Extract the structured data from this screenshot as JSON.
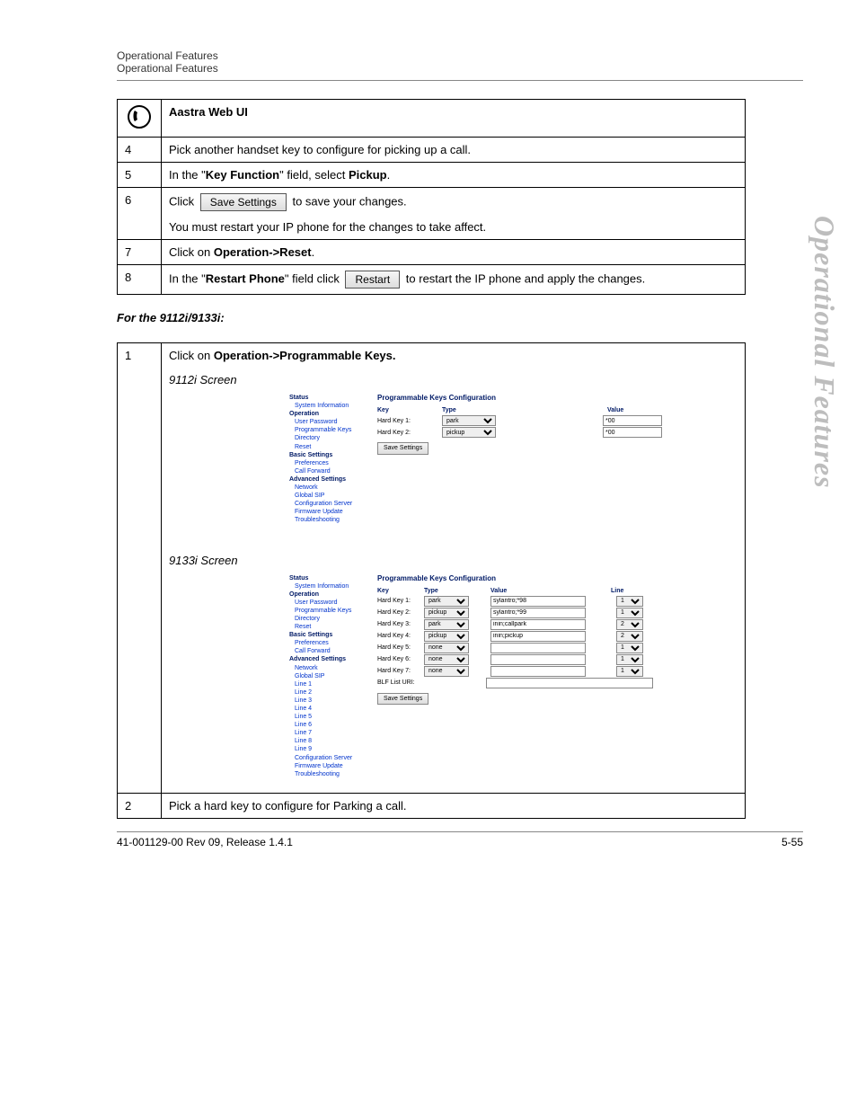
{
  "header": {
    "line1": "Operational Features",
    "line2": "Operational Features"
  },
  "side_title": "Operational Features",
  "webui": {
    "title": "Aastra Web UI",
    "steps": {
      "s4": {
        "num": "4",
        "text": "Pick another handset key to configure for picking up a call."
      },
      "s5": {
        "num": "5",
        "pre": "In the \"",
        "bold": "Key Function",
        "post": "\" field, select ",
        "bold2": "Pickup",
        "tail": "."
      },
      "s6": {
        "num": "6",
        "pre": "Click ",
        "btn": "Save Settings",
        "post": " to save your changes.",
        "note": "You must restart your IP phone for the changes to take affect."
      },
      "s7": {
        "num": "7",
        "pre": "Click on ",
        "bold": "Operation->Reset",
        "tail": "."
      },
      "s8": {
        "num": "8",
        "pre": "In the \"",
        "bold": "Restart Phone",
        "mid": "\" field click ",
        "btn": "Restart",
        "post": " to restart the IP phone and apply the changes."
      }
    },
    "subhead": "For the 9112i/9133i:",
    "step1": {
      "num": "1",
      "pre": "Click on ",
      "bold": "Operation->Programmable Keys."
    },
    "screen1_label": "9112i Screen",
    "screen2_label": "9133i Screen",
    "step2": {
      "num": "2",
      "text": "Pick a hard key to configure for Parking a call."
    }
  },
  "nav": {
    "status": "Status",
    "sysinfo": "System Information",
    "operation": "Operation",
    "userpw": "User Password",
    "progkeys": "Programmable Keys",
    "directory": "Directory",
    "reset": "Reset",
    "basic": "Basic Settings",
    "prefs": "Preferences",
    "callfwd": "Call Forward",
    "advanced": "Advanced Settings",
    "network": "Network",
    "globalsip": "Global SIP",
    "cfgsrv": "Configuration Server",
    "fwupd": "Firmware Update",
    "tshoot": "Troubleshooting",
    "lines": [
      "Line 1",
      "Line 2",
      "Line 3",
      "Line 4",
      "Line 5",
      "Line 6",
      "Line 7",
      "Line 8",
      "Line 9"
    ]
  },
  "ui9112": {
    "title": "Programmable Keys Configuration",
    "cols": {
      "key": "Key",
      "type": "Type",
      "value": "Value"
    },
    "rows": [
      {
        "key": "Hard Key 1:",
        "type": "park",
        "value": "*00"
      },
      {
        "key": "Hard Key 2:",
        "type": "pickup",
        "value": "*00"
      }
    ],
    "save": "Save Settings"
  },
  "ui9133": {
    "title": "Programmable Keys Configuration",
    "cols": {
      "key": "Key",
      "type": "Type",
      "value": "Value",
      "line": "Line"
    },
    "rows": [
      {
        "key": "Hard Key 1:",
        "type": "park",
        "value": "sylantro;*98",
        "line": "1"
      },
      {
        "key": "Hard Key 2:",
        "type": "pickup",
        "value": "sylantro;*99",
        "line": "1"
      },
      {
        "key": "Hard Key 3:",
        "type": "park",
        "value": "inin;callpark",
        "line": "2"
      },
      {
        "key": "Hard Key 4:",
        "type": "pickup",
        "value": "inin;pickup",
        "line": "2"
      },
      {
        "key": "Hard Key 5:",
        "type": "none",
        "value": "",
        "line": "1"
      },
      {
        "key": "Hard Key 6:",
        "type": "none",
        "value": "",
        "line": "1"
      },
      {
        "key": "Hard Key 7:",
        "type": "none",
        "value": "",
        "line": "1"
      }
    ],
    "blf_label": "BLF List URI:",
    "blf_value": "",
    "save": "Save Settings"
  },
  "footer": {
    "left": "41-001129-00 Rev 09, Release 1.4.1",
    "right": "5-55"
  }
}
